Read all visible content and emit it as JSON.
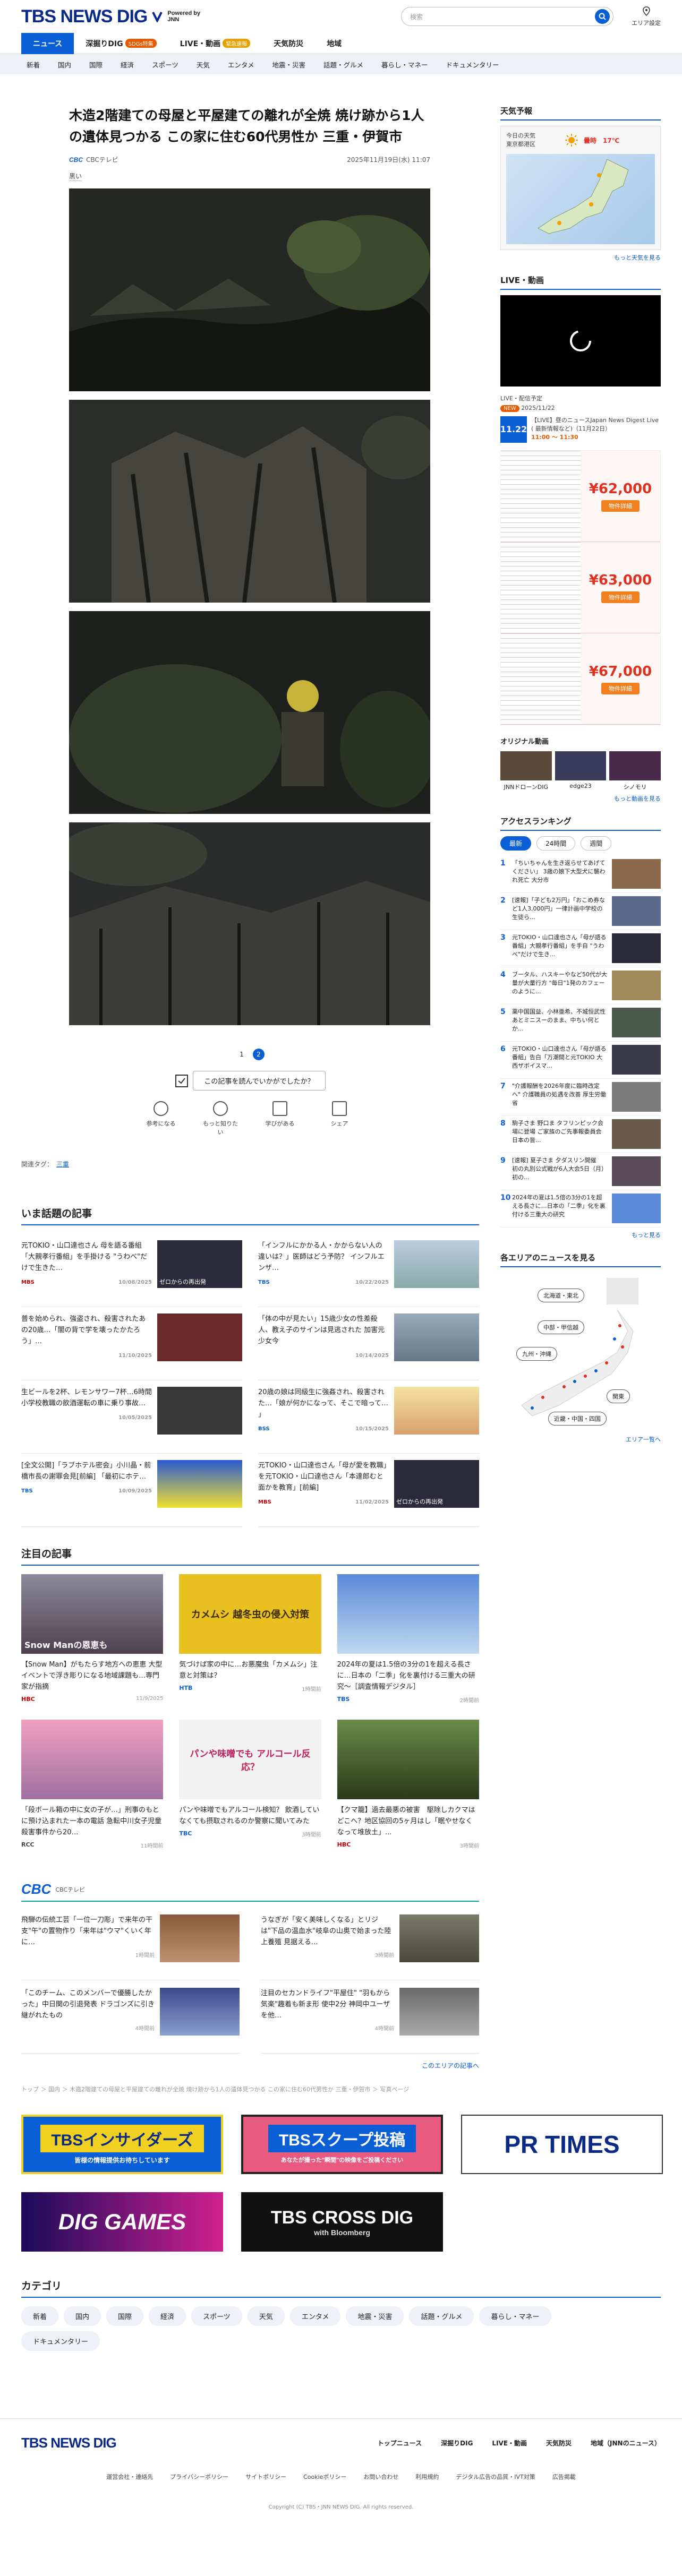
{
  "header": {
    "logo_main": "TBS NEWS DIG",
    "logo_powered": "Powered by JNN",
    "search_placeholder": "検索",
    "area_label": "エリア設定"
  },
  "main_nav": [
    {
      "label": "ニュース",
      "badge": ""
    },
    {
      "label": "深掘りDIG",
      "badge": "SDGs特集"
    },
    {
      "label": "LIVE・動画",
      "badge": "緊急速報"
    },
    {
      "label": "天気防災",
      "badge": ""
    },
    {
      "label": "地域",
      "badge": ""
    }
  ],
  "sub_nav": [
    "新着",
    "国内",
    "国際",
    "経済",
    "スポーツ",
    "天気",
    "エンタメ",
    "地震・災害",
    "話題・グルメ",
    "暮らし・マネー",
    "ドキュメンタリー"
  ],
  "article": {
    "title": "木造2階建ての母屋と平屋建ての離れが全焼 焼け跡から1人の遺体見つかる この家に住む60代男性か 三重・伊賀市",
    "source_logo": "CBC",
    "source_name": "CBCテレビ",
    "datetime": "2025年11月19日(水) 11:07",
    "caption": "黒い",
    "pages": [
      "1",
      "2"
    ],
    "ask_text": "この記事を読んでいかがでしたか？",
    "reactions": [
      "参考になる",
      "もっと知りたい",
      "学びがある",
      "シェア"
    ],
    "tags_label": "関連タグ：",
    "tag": "三重"
  },
  "trending": {
    "title": "いま話題の記事",
    "items": [
      {
        "text": "元TOKIO・山口達也さん 母を語る番組「大親孝行番組」を手掛ける \"うわべ\"だけで生きた…",
        "src": "MBS",
        "date": "10/08/2025",
        "thumb": "ゼロからの再出発"
      },
      {
        "text": "「インフルにかかる人・かからない人の違いは？」医師はどう予防？ インフルエンザ…",
        "src": "TBS",
        "date": "10/22/2025",
        "thumb": ""
      },
      {
        "text": "普を始められ、強盗され、殺害されたあの20歳…「闇の背で学を壊ったかたろう」…",
        "src": "",
        "date": "11/10/2025",
        "thumb": ""
      },
      {
        "text": "「体の中が見たい」15歳少女の性差殺人、教え子のサインは見逃された 加害元少女今",
        "src": "",
        "date": "10/14/2025",
        "thumb": ""
      },
      {
        "text": "生ビールを2杯、レモンサワー7杯…6時間 小学校教職の飲酒運転の車に乗り事故…",
        "src": "",
        "date": "10/05/2025",
        "thumb": ""
      },
      {
        "text": "20歳の娘は同級生に強姦され、殺害された…「娘が何かになって、そこで暗って… 」",
        "src": "BSS",
        "date": "10/15/2025",
        "thumb": ""
      },
      {
        "text": "[全文公開]「ラブホテル密会」小川晶・前橋市長の謝罪会見[前編] 「最初にホテ…",
        "src": "TBS",
        "date": "10/09/2025",
        "thumb": ""
      },
      {
        "text": "元TOKIO・山口達也さん「母が愛を教職」を元TOKIO・山口達也さん「本達郎むと面かを教育」[前編]",
        "src": "MBS",
        "date": "11/02/2025",
        "thumb": "ゼロからの再出発"
      }
    ]
  },
  "featured": {
    "title": "注目の記事",
    "items": [
      {
        "text": "【Snow Man】がもたらす地方への恵恵 大型イベントで浮き彫りになる地域課題も…専門家が指摘",
        "src": "HBC",
        "date": "11/9/2025",
        "thumb": "Snow Manの恩恵も"
      },
      {
        "text": "気づけば家の中に…お悪魔虫「カメムシ」注意と対策は？",
        "src": "HTB",
        "date": "1時間前",
        "thumb": "カメムシ 越冬虫の侵入対策"
      },
      {
        "text": "2024年の夏は1.5倍の3分の1を超える長さに…日本の「二季」化を裏付ける三重大の研究〜［調査情報デジタル］",
        "src": "TBS",
        "date": "2時間前",
        "thumb": ""
      },
      {
        "text": "「段ボール箱の中に女の子が…」刑事のもとに預け込まれた一本の電話 急転中川女子児童殺害事件から20…",
        "src": "RCC",
        "date": "11時間前",
        "thumb": ""
      },
      {
        "text": "パンや味噌でもアルコール検知？ 飲酒していなくても摂取されるのか警察に聞いてみた",
        "src": "TBC",
        "date": "3時間前",
        "thumb": "パンや味噌でも アルコール反応？"
      },
      {
        "text": "【クマ籠】過去最悪の被害　駆除しカクマはどこへ？地区協回の5ヶ月はし「眠やせなくなって堆放土」...",
        "src": "HBC",
        "date": "3時間前",
        "thumb": ""
      }
    ]
  },
  "cbc": {
    "logo": "CBC",
    "sub": "CBCテレビ",
    "items": [
      {
        "text": "飛騨の伝統工芸「一位一刀彫」で来年の干支\"午\"の置物作り「来年は\"ウマ\"くいく年に…",
        "date": "1時間前"
      },
      {
        "text": "うなぎが「安く美味しくなる」とリジは\"下品の温血水\"岐阜の山奥で始まった陸上養殖 見据える…",
        "date": "3時間前"
      },
      {
        "text": "「このチーム、このメンバーで優勝したかった」中日関の引退発表 ドラゴンズに引き継がれたもの",
        "date": "4時間前"
      },
      {
        "text": "注目のセカンドライフ\"平屋住\" \"羽もから気楽\"趣着も新ま形 使中2分 神岡中ユーザを他…",
        "date": "4時間前"
      }
    ],
    "more": "このエリアの記事へ"
  },
  "breadcrumb": "トップ ＞ 国内 ＞ 木造2階建ての母屋と平屋建ての離れが全焼 焼け跡から1人の遺体見つかる この家に住む60代男性か 三重・伊賀市 ＞ 写真ページ",
  "banners": {
    "insiders": "TBSインサイダーズ",
    "insiders_sub": "皆様の情報提供お待ちしています",
    "scoop": "TBSスクープ投稿",
    "scoop_sub": "あなたが撮った\"瞬間\"の映像をご投稿ください",
    "prtimes": "PR TIMES",
    "diggames": "DIG GAMES",
    "crossdig": "TBS CROSS DIG",
    "crossdig_sub": "with Bloomberg"
  },
  "categories": {
    "title": "カテゴリ",
    "items": [
      "新着",
      "国内",
      "国際",
      "経済",
      "スポーツ",
      "天気",
      "エンタメ",
      "地震・災害",
      "話題・グルメ",
      "暮らし・マネー",
      "ドキュメンタリー"
    ]
  },
  "sidebar": {
    "weather": {
      "title": "天気予報",
      "today": "今日の天気",
      "location": "東京都港区",
      "forecast": "曇時　17℃",
      "more": "もっと天気を見る"
    },
    "live": {
      "title": "LIVE・動画",
      "sched_title": "LIVE・配信予定",
      "sched_badge": "NEW",
      "sched_date": "2025/11/22",
      "sched_day": "11.22",
      "sched_text": "【LIVE】昼のニュースJapan News Digest Live ( 最新情報など)（11月22日）",
      "sched_time": "11:00 〜 11:30"
    },
    "ads": [
      {
        "price": "¥62,000",
        "btn": "物件詳細"
      },
      {
        "price": "¥63,000",
        "btn": "物件詳細"
      },
      {
        "price": "¥67,000",
        "btn": "物件詳細"
      }
    ],
    "orig": {
      "title": "オリジナル動画",
      "items": [
        "JNNドローンDIG",
        "edge23",
        "シノモリ"
      ],
      "more": "もっと動画を見る"
    },
    "ranking": {
      "title": "アクセスランキング",
      "tabs": [
        "最新",
        "24時間",
        "週間"
      ],
      "items": [
        "「ちいちゃんを生き返らせてあげてください」 3歳の娘下大型犬に襲われ死亡 大分市",
        "[速報]「子ども2万円」「おこめ券など1人3,000円」一律計画中学校の生徒ら...",
        "元TOKIO・山口達也さん「母が語る番組」大親孝行番組」を手自 \"うわべ\"だけで生き...",
        "ブータル、ハスキーやなど50代が大量が大量行方 \"毎日\"1発のカフェーのように...",
        "薬中国国益、小林亜希、不城恒武性あとミニスーのまま、中ちい何とか... ",
        "元TOKIO・山口達也さん「母が語る番組」告白「万潮間と元TOKIO 大西ザボイスマ...",
        "\"介護報酬を2026年度に臨時改定へ\" 介護職員の処遇を改善 厚生労働省",
        "駒子さま 野口ま タフリンピック会場に登場 ご家族のご先事報委員会 日本の皆...",
        "[速報] 夏子さま 夕ダスリン開催　初の丸別公式戦が6人大会5日（月）初の...",
        "2024年の夏は1.5倍の3分の1を超える長さに…日本の「二季」化を裏付ける三重大の研究"
      ],
      "more": "もっと見る"
    },
    "areas": {
      "title": "各エリアのニュースを見る",
      "buttons": [
        "北海道・東北",
        "中部・甲信越",
        "九州・沖縄",
        "関東",
        "近畿・中国・四国"
      ],
      "more": "エリア一覧へ"
    }
  },
  "footer": {
    "logo": "TBS NEWS DIG",
    "links_top": [
      "トップニュース",
      "深掘りDIG",
      "LIVE・動画",
      "天気防災",
      "地域（JNNのニュース）"
    ],
    "links_bottom": [
      "運営会社・連絡先",
      "プライバシーポリシー",
      "サイトポリシー",
      "Cookieポリシー",
      "お問い合わせ",
      "利用規約",
      "デジタル広告の品質・IVT対策",
      "広告掲載"
    ],
    "copyright": "Copyright (C) TBS・JNN NEWS DIG. All rights reserved."
  },
  "colors": {
    "brand": "#0a2a85",
    "accent": "#0a5ed6",
    "badge": "#e85a00",
    "price": "#e03020"
  }
}
